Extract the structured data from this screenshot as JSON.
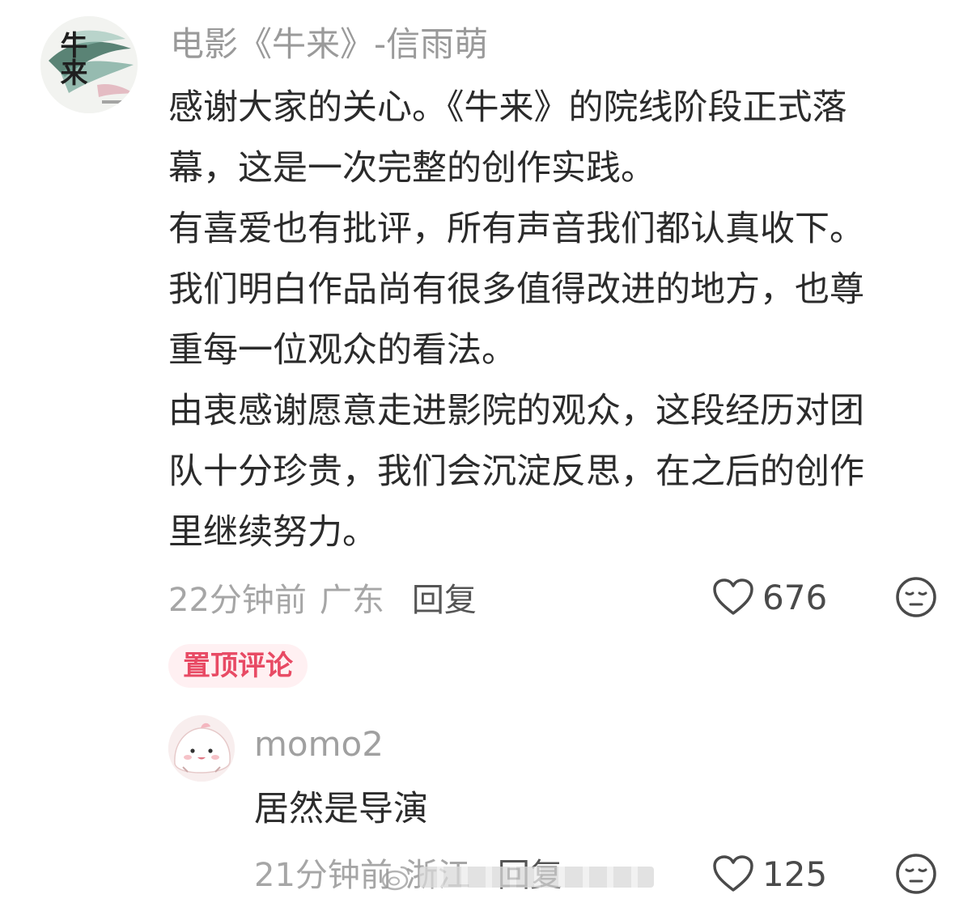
{
  "main_comment": {
    "username": "电影《牛来》-信雨萌",
    "avatar_icon": "movie-poster-avatar",
    "avatar_logo_text": "牛来",
    "paragraphs": [
      "感谢大家的关心。《牛来》的院线阶段正式落",
      "幕，这是一次完整的创作实践。",
      "有喜爱也有批评，所有声音我们都认真收下。",
      "我们明白作品尚有很多值得改进的地方，也尊",
      "重每一位观众的看法。",
      "由衷感谢愿意走进影院的观众，这段经历对团",
      "队十分珍贵，我们会沉淀反思，在之后的创作",
      "里继续努力。"
    ],
    "time": "22分钟前",
    "location": "广东",
    "reply_label": "回复",
    "like_count": "676",
    "pinned_label": "置顶评论"
  },
  "reply_comment": {
    "username": "momo2",
    "avatar_icon": "cartoon-bun-avatar",
    "text": "居然是导演",
    "time": "21分钟前",
    "location": "浙江",
    "reply_label": "回复",
    "like_count": "125"
  },
  "colors": {
    "username": "#9a9a9a",
    "body_text": "#2b2b2b",
    "meta_text": "#a6a6a6",
    "pinned_bg": "#fff0f2",
    "pinned_text": "#e84a64"
  }
}
